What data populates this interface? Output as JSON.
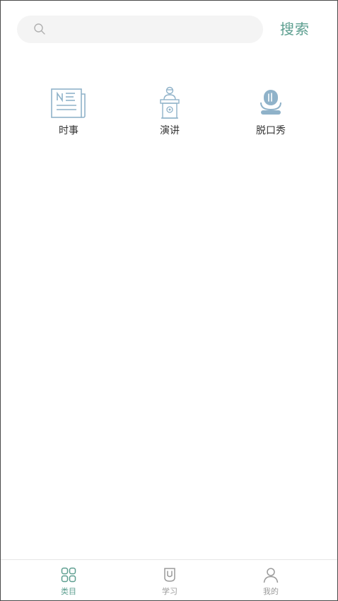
{
  "search": {
    "placeholder": "",
    "value": "",
    "button_label": "搜索",
    "icon": "search-icon"
  },
  "categories": [
    {
      "label": "时事",
      "icon": "newspaper-icon"
    },
    {
      "label": "演讲",
      "icon": "podium-speaker-icon"
    },
    {
      "label": "脱口秀",
      "icon": "microphone-icon"
    }
  ],
  "tabbar": {
    "active_color": "#5c9e8f",
    "inactive_color": "#9a9a9a",
    "items": [
      {
        "label": "类目",
        "icon": "grid-icon",
        "active": true
      },
      {
        "label": "学习",
        "icon": "book-icon",
        "active": false
      },
      {
        "label": "我的",
        "icon": "user-icon",
        "active": false
      }
    ]
  },
  "colors": {
    "accent": "#5c9e8f",
    "icon_blue": "#8fb2c9",
    "search_bg": "#f4f4f4"
  }
}
